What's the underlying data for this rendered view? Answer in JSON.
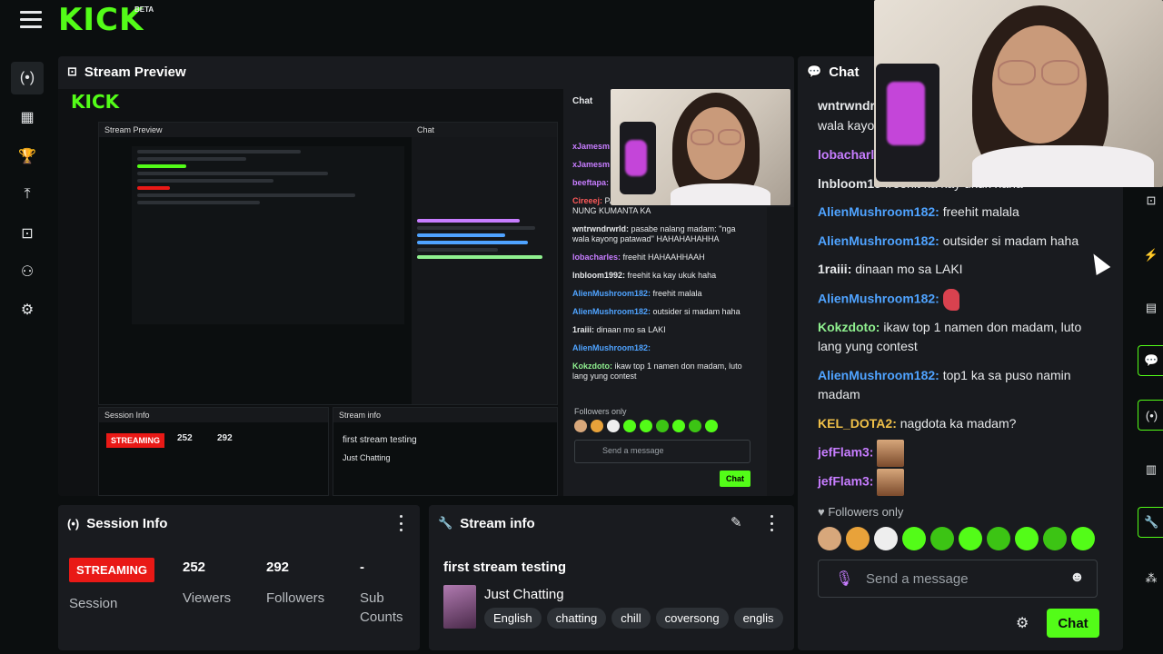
{
  "brand": {
    "logo": "KICK",
    "beta": "BETA"
  },
  "preview": {
    "title": "Stream Preview"
  },
  "nested": {
    "title": "Stream Preview",
    "chat_title": "Chat",
    "session_title": "Session Info",
    "streaminfo_title": "Stream info"
  },
  "preview_chat": {
    "lines": [
      {
        "user": "xJamesm",
        "text": "",
        "color": "#c77dff"
      },
      {
        "user": "xJamesm",
        "text": "",
        "color": "#c77dff"
      },
      {
        "user": "beeftapa:",
        "text": "",
        "color": "#c77dff"
      },
      {
        "user": "Cireeej:",
        "text": "PARANG BABY NGA PO TALAGA NUNG KUMANTA KA",
        "color": "#ff5a5a"
      },
      {
        "user": "wntrwndrwrld:",
        "text": "pasabe nalang madam: ''nga wala kayong patawad'' HAHAHAHAHHA",
        "color": "#e6e8ea"
      },
      {
        "user": "lobacharles:",
        "text": "freehit HAHAAHHAAH",
        "color": "#c77dff"
      },
      {
        "user": "lnbloom1992:",
        "text": "freehit ka kay ukuk haha",
        "color": "#e6e8ea"
      },
      {
        "user": "AlienMushroom182:",
        "text": "freehit malala",
        "color": "#4fa3ff"
      },
      {
        "user": "AlienMushroom182:",
        "text": "outsider si madam haha",
        "color": "#4fa3ff"
      },
      {
        "user": "1raiii:",
        "text": "dinaan mo sa LAKI",
        "color": "#e6e8ea"
      },
      {
        "user": "AlienMushroom182:",
        "text": "",
        "color": "#4fa3ff"
      },
      {
        "user": "Kokzdoto:",
        "text": "ikaw top 1 namen don madam, luto lang yung contest",
        "color": "#8ff08f"
      }
    ],
    "followers_only": "Followers only",
    "placeholder": "Send a message",
    "chat_button": "Chat"
  },
  "session": {
    "title": "Session Info",
    "status": "STREAMING",
    "session_label": "Session",
    "viewers": "252",
    "viewers_label": "Viewers",
    "followers": "292",
    "followers_label": "Followers",
    "subs": "-",
    "subs_label": "Sub Counts"
  },
  "streaminfo": {
    "title": "Stream info",
    "stream_title": "first stream testing",
    "category": "Just Chatting",
    "tags": [
      "English",
      "chatting",
      "chill",
      "coversong",
      "englis"
    ]
  },
  "chat": {
    "title": "Chat",
    "messages": [
      {
        "user": "wntrwndr",
        "text": "",
        "color": "#e6e8ea"
      },
      {
        "user": "",
        "text": "wala kayo",
        "color": "#e6e8ea"
      },
      {
        "user": "lobacharl",
        "text": "",
        "color": "#c77dff"
      },
      {
        "user": "lnbloom19",
        "text": "freehit ka kay ukuk haha",
        "color": "#e6e8ea"
      },
      {
        "user": "AlienMushroom182:",
        "text": "freehit malala",
        "color": "#4fa3ff"
      },
      {
        "user": "AlienMushroom182:",
        "text": "outsider si madam haha",
        "color": "#4fa3ff"
      },
      {
        "user": "1raiii:",
        "text": "dinaan mo sa LAKI",
        "color": "#e6e8ea"
      },
      {
        "user": "AlienMushroom182:",
        "text": "",
        "color": "#4fa3ff"
      },
      {
        "user": "Kokzdoto:",
        "text": "ikaw top 1 namen don madam, luto lang yung contest",
        "color": "#8ff08f"
      },
      {
        "user": "AlienMushroom182:",
        "text": "top1 ka sa puso namin madam",
        "color": "#4fa3ff"
      },
      {
        "user": "KEL_DOTA2:",
        "text": "nagdota ka madam?",
        "color": "#f0c048"
      },
      {
        "user": "jefFlam3:",
        "text": "",
        "color": "#c77dff"
      },
      {
        "user": "jefFlam3:",
        "text": "",
        "color": "#c77dff"
      }
    ],
    "followers_only": "Followers only",
    "placeholder": "Send a message",
    "chat_button": "Chat"
  },
  "colors": {
    "accent": "#53fc18",
    "streaming": "#e91916",
    "panel": "#191b1f",
    "bg": "#0b0e0f"
  }
}
